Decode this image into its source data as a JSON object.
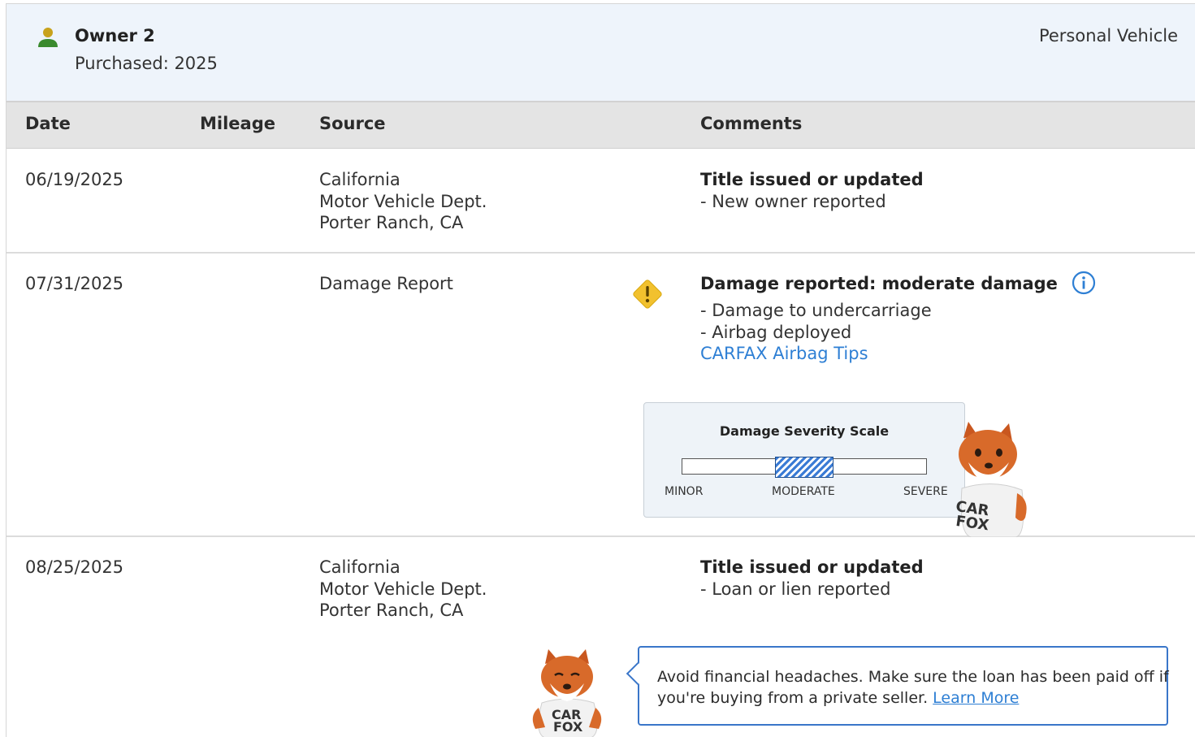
{
  "owner": {
    "title": "Owner 2",
    "purchased": "Purchased: 2025",
    "vehicle_type": "Personal Vehicle"
  },
  "columns": {
    "date": "Date",
    "mileage": "Mileage",
    "source": "Source",
    "comments": "Comments"
  },
  "rows": [
    {
      "date": "06/19/2025",
      "source": [
        "California",
        "Motor Vehicle Dept.",
        "Porter Ranch, CA"
      ],
      "comment_title": "Title issued or updated",
      "comment_lines": [
        "- New owner reported"
      ]
    },
    {
      "date": "07/31/2025",
      "source": [
        "Damage Report"
      ],
      "comment_title": "Damage reported: moderate damage",
      "comment_lines": [
        "- Damage to undercarriage",
        "- Airbag deployed"
      ],
      "link": "CARFAX Airbag Tips"
    },
    {
      "date": "08/25/2025",
      "source": [
        "California",
        "Motor Vehicle Dept.",
        "Porter Ranch, CA"
      ],
      "comment_title": "Title issued or updated",
      "comment_lines": [
        "- Loan or lien reported"
      ]
    }
  ],
  "severity": {
    "title": "Damage Severity Scale",
    "labels": [
      "MINOR",
      "MODERATE",
      "SEVERE"
    ],
    "level": "MODERATE",
    "range_start_fraction": 0.38,
    "range_end_fraction": 0.62
  },
  "fox_shirt": [
    "CAR",
    "FOX"
  ],
  "tip": {
    "text_line1": "Avoid financial headaches. Make sure the loan has been paid off if",
    "text_line2": "you're buying from a private seller.",
    "link": "Learn More"
  },
  "colors": {
    "accent": "#2e7fd4",
    "warning": "#f2c12e",
    "owner_icon_head": "#c8a21c",
    "owner_icon_body": "#3a8a2e",
    "header_bg": "#eef4fb"
  }
}
